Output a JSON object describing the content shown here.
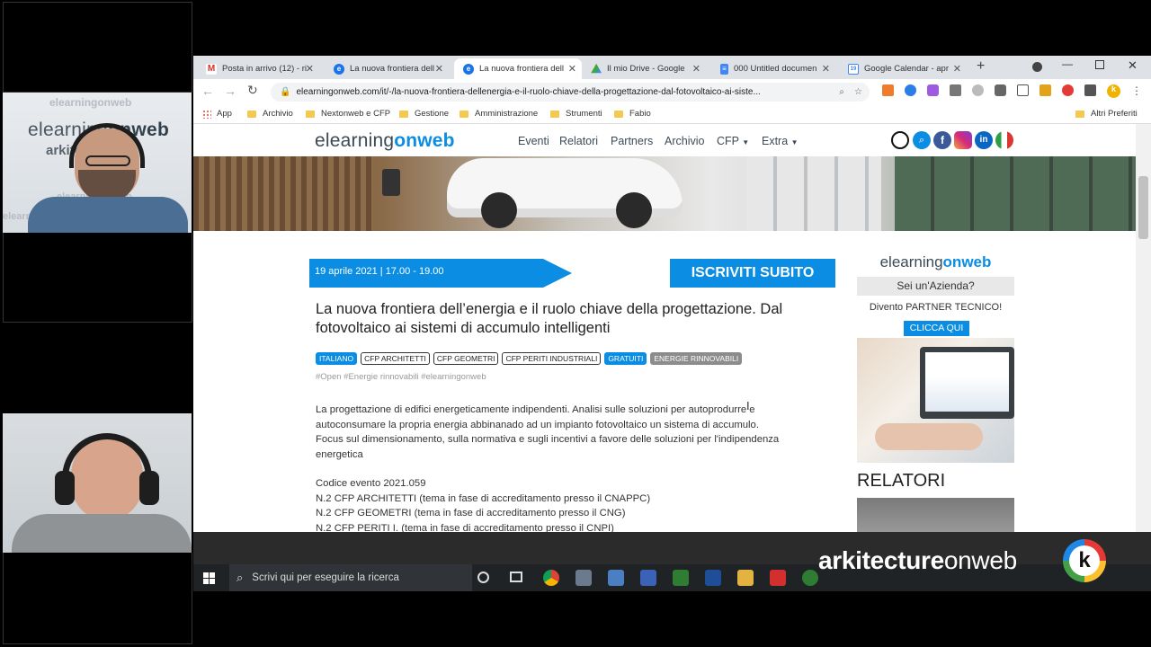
{
  "tabs": [
    {
      "label": "Posta in arrivo (12) - ri",
      "icon": "gmail-icon",
      "color": "#d93025"
    },
    {
      "label": "La nuova frontiera dell",
      "icon": "edge-e-icon",
      "color": "#1a73e8"
    },
    {
      "label": "La nuova frontiera dell",
      "icon": "edge-e-icon",
      "color": "#1a73e8",
      "active": true
    },
    {
      "label": "Il mio Drive - Google",
      "icon": "drive-icon",
      "color": "#34a853"
    },
    {
      "label": "000 Untitled documen",
      "icon": "docs-icon",
      "color": "#4285f4"
    },
    {
      "label": "Google Calendar - apr",
      "icon": "calendar-icon",
      "color": "#4285f4"
    }
  ],
  "address": {
    "url": "elearningonweb.com/it/-/la-nuova-frontiera-dellenergia-e-il-ruolo-chiave-della-progettazione-dal-fotovoltaico-ai-siste..."
  },
  "bookmarks": {
    "app": "App",
    "items": [
      "Archivio",
      "Nextonweb e CFP",
      "Gestione",
      "Amministrazione",
      "Strumenti",
      "Fabio"
    ],
    "other": "Altri Preferiti"
  },
  "site": {
    "logo_a": "elearning",
    "logo_b": "onweb",
    "nav": [
      "Eventi",
      "Relatori",
      "Partners",
      "Archivio",
      "CFP",
      "Extra"
    ],
    "date_bar": "19 aprile 2021 | 17.00 - 19.00",
    "cta": "ISCRIVITI SUBITO",
    "title": "La nuova frontiera dell’energia e il ruolo chiave della progettazione. Dal fotovoltaico ai sistemi di accumulo intelligenti",
    "badges": [
      {
        "label": "ITALIANO",
        "style": "blue"
      },
      {
        "label": "CFP ARCHITETTI",
        "style": "outline"
      },
      {
        "label": "CFP GEOMETRI",
        "style": "outline"
      },
      {
        "label": "CFP PERITI INDUSTRIALI",
        "style": "outline"
      },
      {
        "label": "GRATUITI",
        "style": "blue"
      },
      {
        "label": "ENERGIE RINNOVABILI",
        "style": "grey"
      }
    ],
    "hashtags": "#Open #Energie rinnovabili #elearningonweb",
    "description": [
      "La progettazione di edifici energeticamente indipendenti. Analisi sulle soluzioni per autoprodurre e",
      "autoconsumare la propria  energia abbinanado ad un impianto fotovoltaico un sistema di accumulo.",
      "Focus sul dimensionamento, sulla normativa e sugli incentivi a favore delle soluzioni per l'indipendenza",
      "energetica"
    ],
    "details": [
      "Codice evento 2021.059",
      "N.2 CFP ARCHITETTI (tema in fase di accreditamento presso il CNAPPC)",
      "N.2 CFP GEOMETRI (tema in fase di accreditamento presso il CNG)",
      "N.2 CFP PERITI I. (tema in fase di accreditamento presso il CNPI)"
    ],
    "sidebar": {
      "logo_a": "elearning",
      "logo_b": "onweb",
      "question": "Sei un'Azienda?",
      "partner": "Divento PARTNER TECNICO!",
      "button": "CLICCA QUI",
      "relatori": "RELATORI"
    }
  },
  "overlay": {
    "brand_a": "arkitecture",
    "brand_b": "onweb"
  },
  "taskbar": {
    "search_placeholder": "Scrivi qui per eseguire la ricerca"
  },
  "webcam": {
    "bg_logo_a": "elearning",
    "bg_logo_b": "onweb",
    "bg_small": "elearningonweb",
    "bg_ark": "arkitec"
  },
  "colors": {
    "accent": "#0a8de2",
    "chrome_tabs": "#dee1e6"
  }
}
